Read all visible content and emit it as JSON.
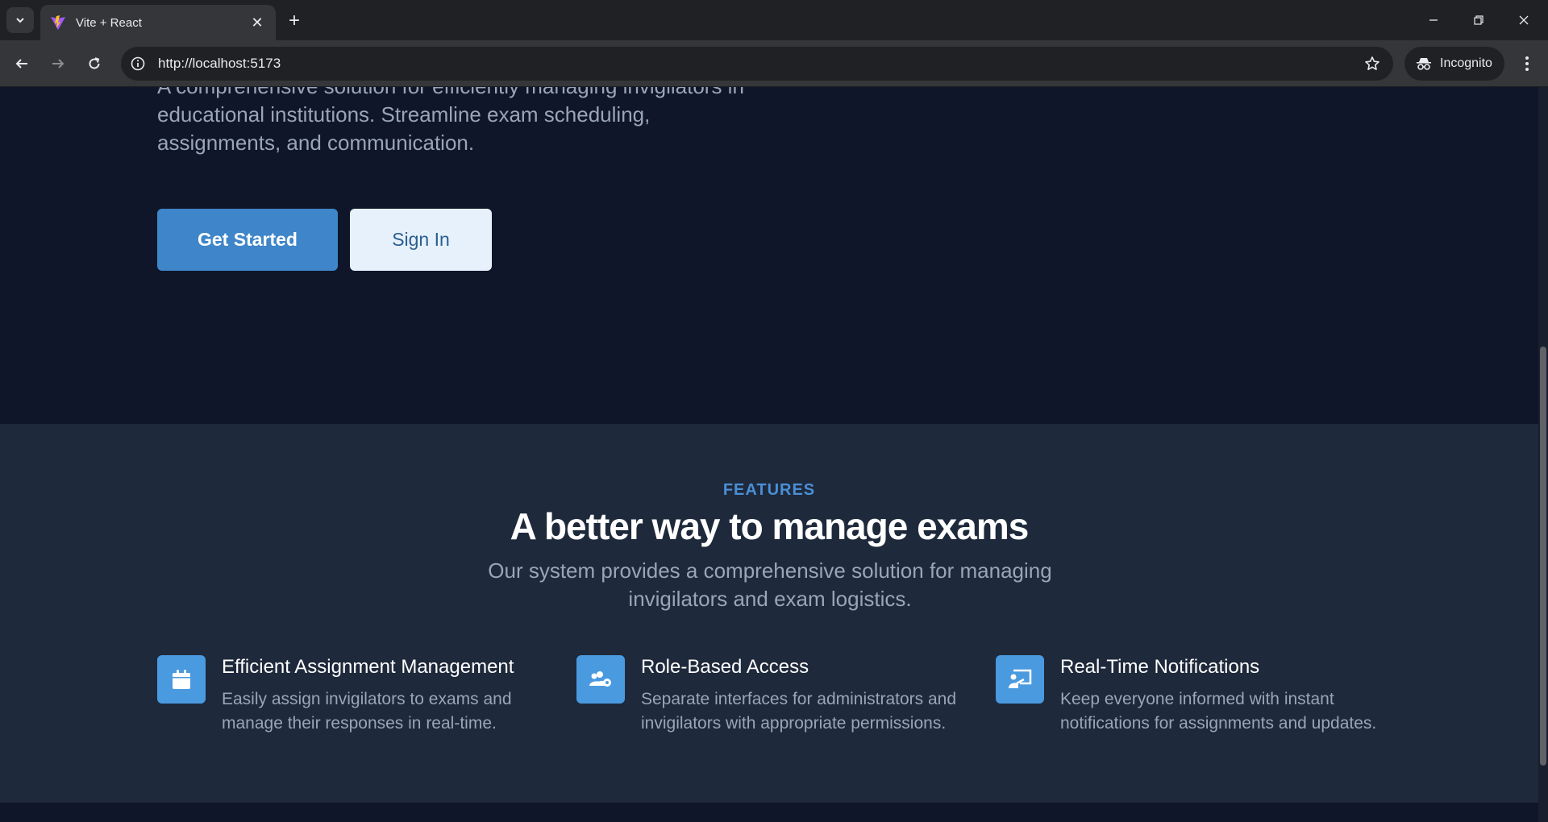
{
  "browser": {
    "tab_title": "Vite + React",
    "url": "http://localhost:5173",
    "incognito_label": "Incognito"
  },
  "hero": {
    "description": "A comprehensive solution for efficiently managing invigilators in educational institutions. Streamline exam scheduling, assignments, and communication.",
    "primary_button": "Get Started",
    "secondary_button": "Sign In"
  },
  "features": {
    "eyebrow": "FEATURES",
    "title": "A better way to manage exams",
    "subtitle": "Our system provides a comprehensive solution for managing invigilators and exam logistics.",
    "items": [
      {
        "icon": "calendar-icon",
        "title": "Efficient Assignment Management",
        "description": "Easily assign invigilators to exams and manage their responses in real-time."
      },
      {
        "icon": "user-gear-icon",
        "title": "Role-Based Access",
        "description": "Separate interfaces for administrators and invigilators with appropriate permissions."
      },
      {
        "icon": "presentation-icon",
        "title": "Real-Time Notifications",
        "description": "Keep everyone informed with instant notifications for assignments and updates."
      }
    ]
  },
  "colors": {
    "accent": "#3f85c9",
    "hero_bg": "#0f1629",
    "features_bg": "#1e293b"
  }
}
